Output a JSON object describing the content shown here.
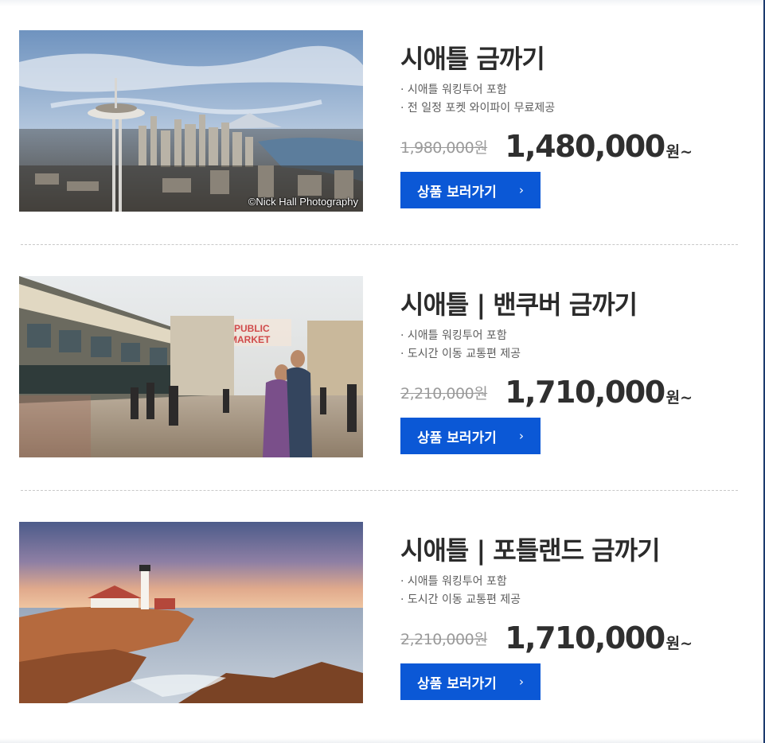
{
  "products": [
    {
      "title": "시애틀 금까기",
      "features": [
        "· 시애틀 워킹투어 포함",
        "· 전 일정 포켓 와이파이 무료제공"
      ],
      "old_price": "1,980,000원",
      "price": "1,480,000",
      "unit": "원~",
      "button_label": "상품 보러가기",
      "button_arrow": "›",
      "photo_credit": "©Nick Hall Photography"
    },
    {
      "title": "시애틀 | 밴쿠버 금까기",
      "features": [
        "· 시애틀 워킹투어 포함",
        "· 도시간 이동 교통편 제공"
      ],
      "old_price": "2,210,000원",
      "price": "1,710,000",
      "unit": "원~",
      "button_label": "상품 보러가기",
      "button_arrow": "›"
    },
    {
      "title": "시애틀 | 포틀랜드 금까기",
      "features": [
        "· 시애틀 워킹투어 포함",
        "· 도시간 이동 교통편 제공"
      ],
      "old_price": "2,210,000원",
      "price": "1,710,000",
      "unit": "원~",
      "button_label": "상품 보러가기",
      "button_arrow": "›"
    }
  ],
  "colors": {
    "button": "#0b58d6",
    "title": "#2b2b2b",
    "old_price": "#9a9a9a",
    "accent_rule": "#1c3a6e"
  }
}
